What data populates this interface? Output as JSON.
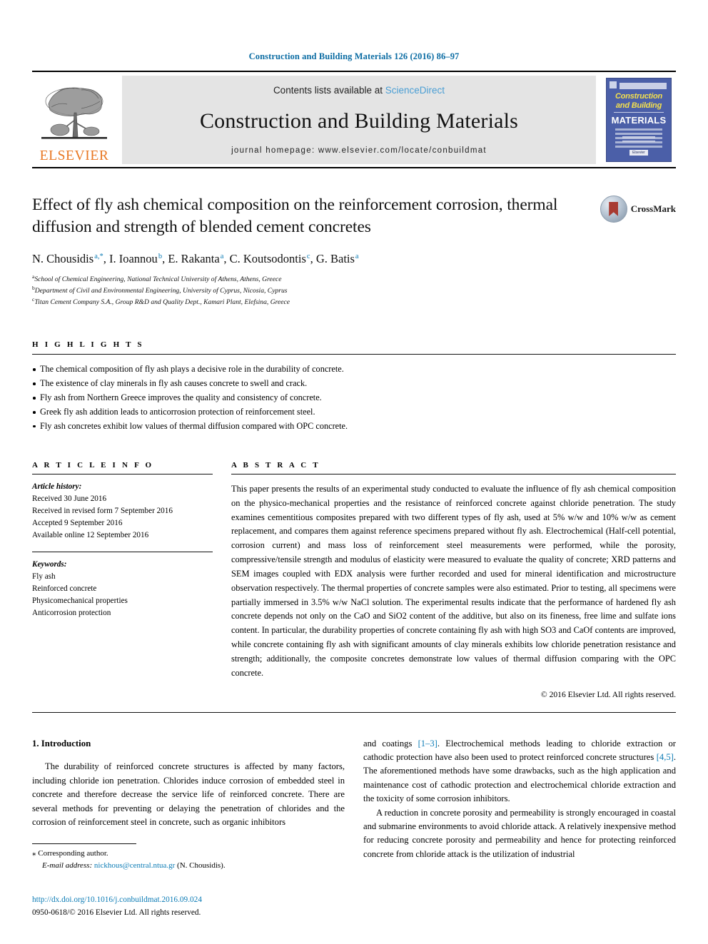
{
  "running_head": "Construction and Building Materials 126 (2016) 86–97",
  "masthead": {
    "publisher_name": "ELSEVIER",
    "contents_prefix": "Contents lists available at ",
    "contents_link": "ScienceDirect",
    "journal_title": "Construction and Building Materials",
    "homepage": "journal homepage: www.elsevier.com/locate/conbuildmat",
    "cover": {
      "line1": "Construction",
      "line2": "and Building",
      "line3": "MATERIALS",
      "badge": "Elsevier"
    }
  },
  "article": {
    "title": "Effect of fly ash chemical composition on the reinforcement corrosion, thermal diffusion and strength of blended cement concretes",
    "crossmark_label": "CrossMark",
    "authors": [
      {
        "name": "N. Chousidis",
        "marks": "a,*"
      },
      {
        "name": "I. Ioannou",
        "marks": "b"
      },
      {
        "name": "E. Rakanta",
        "marks": "a"
      },
      {
        "name": "C. Koutsodontis",
        "marks": "c"
      },
      {
        "name": "G. Batis",
        "marks": "a"
      }
    ],
    "affiliations": [
      {
        "mark": "a",
        "text": "School of Chemical Engineering, National Technical University of Athens, Athens, Greece"
      },
      {
        "mark": "b",
        "text": "Department of Civil and Environmental Engineering, University of Cyprus, Nicosia, Cyprus"
      },
      {
        "mark": "c",
        "text": "Titan Cement Company S.A., Group R&D and Quality Dept., Kamari Plant, Elefsina, Greece"
      }
    ]
  },
  "highlights": {
    "label": "H I G H L I G H T S",
    "items": [
      "The chemical composition of fly ash plays a decisive role in the durability of concrete.",
      "The existence of clay minerals in fly ash causes concrete to swell and crack.",
      "Fly ash from Northern Greece improves the quality and consistency of concrete.",
      "Greek fly ash addition leads to anticorrosion protection of reinforcement steel.",
      "Fly ash concretes exhibit low values of thermal diffusion compared with OPC concrete."
    ]
  },
  "article_info": {
    "label": "A R T I C L E    I N F O",
    "history_label": "Article history:",
    "history": [
      "Received 30 June 2016",
      "Received in revised form 7 September 2016",
      "Accepted 9 September 2016",
      "Available online 12 September 2016"
    ],
    "keywords_label": "Keywords:",
    "keywords": [
      "Fly ash",
      "Reinforced concrete",
      "Physicomechanical properties",
      "Anticorrosion protection"
    ]
  },
  "abstract": {
    "label": "A B S T R A C T",
    "text": "This paper presents the results of an experimental study conducted to evaluate the influence of fly ash chemical composition on the physico-mechanical properties and the resistance of reinforced concrete against chloride penetration. The study examines cementitious composites prepared with two different types of fly ash, used at 5% w/w and 10% w/w as cement replacement, and compares them against reference specimens prepared without fly ash. Electrochemical (Half-cell potential, corrosion current) and mass loss of reinforcement steel measurements were performed, while the porosity, compressive/tensile strength and modulus of elasticity were measured to evaluate the quality of concrete; XRD patterns and SEM images coupled with EDX analysis were further recorded and used for mineral identification and microstructure observation respectively. The thermal properties of concrete samples were also estimated. Prior to testing, all specimens were partially immersed in 3.5% w/w NaCl solution. The experimental results indicate that the performance of hardened fly ash concrete depends not only on the CaO and SiO2 content of the additive, but also on its fineness, free lime and sulfate ions content. In particular, the durability properties of concrete containing fly ash with high SO3 and CaOf contents are improved, while concrete containing fly ash with significant amounts of clay minerals exhibits low chloride penetration resistance and strength; additionally, the composite concretes demonstrate low values of thermal diffusion comparing with the OPC concrete.",
    "copyright": "© 2016 Elsevier Ltd. All rights reserved."
  },
  "introduction": {
    "heading": "1. Introduction",
    "left_paragraph": "The durability of reinforced concrete structures is affected by many factors, including chloride ion penetration. Chlorides induce corrosion of embedded steel in concrete and therefore decrease the service life of reinforced concrete. There are several methods for preventing or delaying the penetration of chlorides and the corrosion of reinforcement steel in concrete, such as organic inhibitors",
    "right_paragraph_1_pre": "and coatings ",
    "right_paragraph_1_ref1": "[1–3]",
    "right_paragraph_1_mid": ". Electrochemical methods leading to chloride extraction or cathodic protection have also been used to protect reinforced concrete structures ",
    "right_paragraph_1_ref2": "[4,5]",
    "right_paragraph_1_post": ". The aforementioned methods have some drawbacks, such as the high application and maintenance cost of cathodic protection and electrochemical chloride extraction and the toxicity of some corrosion inhibitors.",
    "right_paragraph_2": "A reduction in concrete porosity and permeability is strongly encouraged in coastal and submarine environments to avoid chloride attack. A relatively inexpensive method for reducing concrete porosity and permeability and hence for protecting reinforced concrete from chloride attack is the utilization of industrial"
  },
  "footer": {
    "corresponding_mark": "⁎",
    "corresponding_label": "Corresponding author.",
    "email_label": "E-mail address:",
    "email": "nickhous@central.ntua.gr",
    "email_owner": "(N. Chousidis).",
    "doi": "http://dx.doi.org/10.1016/j.conbuildmat.2016.09.024",
    "issn_line": "0950-0618/© 2016 Elsevier Ltd. All rights reserved."
  },
  "colors": {
    "link": "#0b7bb5",
    "elsevier_orange": "#E87722",
    "cover_blue": "#4b5fa8"
  }
}
